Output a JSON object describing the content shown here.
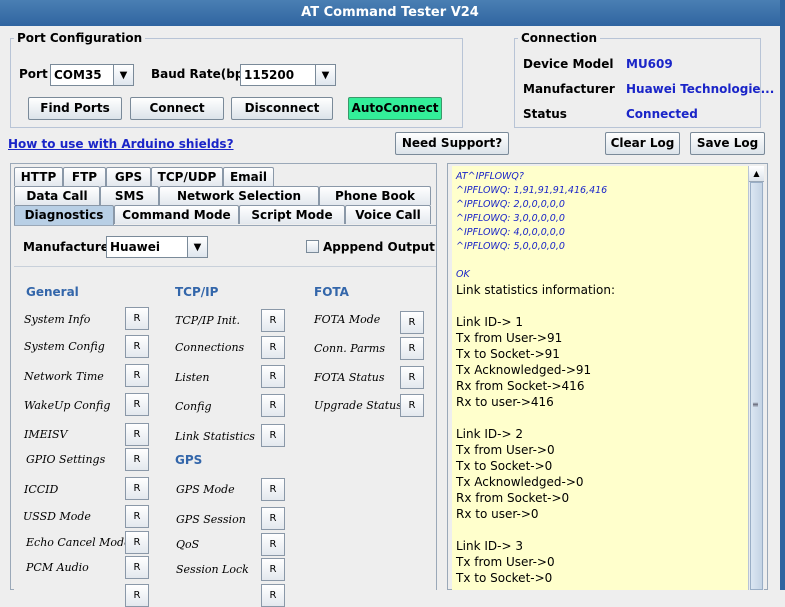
{
  "window": {
    "title": "AT Command Tester V24"
  },
  "port_config": {
    "title": "Port Configuration",
    "port_label": "Port",
    "port_value": "COM35",
    "baud_label": "Baud Rate(bps)",
    "baud_value": "115200",
    "find_ports": "Find Ports",
    "connect": "Connect",
    "disconnect": "Disconnect",
    "autoconnect": "AutoConnect"
  },
  "connection": {
    "title": "Connection",
    "device_model_label": "Device Model",
    "device_model_value": "MU609",
    "manufacturer_label": "Manufacturer",
    "manufacturer_value": "Huawei Technologie...",
    "status_label": "Status",
    "status_value": "Connected"
  },
  "links": {
    "arduino": "How to use with Arduino shields?"
  },
  "actions": {
    "need_support": "Need Support?",
    "clear_log": "Clear Log",
    "save_log": "Save Log"
  },
  "tabs": {
    "row1": [
      "HTTP",
      "FTP",
      "GPS",
      "TCP/UDP",
      "Email"
    ],
    "row2": [
      "Data Call",
      "SMS",
      "Network Selection",
      "Phone Book"
    ],
    "row3": [
      "Diagnostics",
      "Command Mode",
      "Script Mode",
      "Voice Call"
    ],
    "active": "Diagnostics"
  },
  "diagnostics": {
    "manufacturer_label": "Manufacturer",
    "manufacturer_value": "Huawei",
    "append_output": "Apppend Output",
    "r_label": "R",
    "general": {
      "title": "General",
      "items": [
        "System Info",
        "System Config",
        "Network Time",
        "WakeUp Config",
        "IMEISV",
        "GPIO Settings",
        "ICCID",
        "USSD Mode",
        "Echo Cancel Mode",
        "PCM Audio"
      ]
    },
    "tcpip": {
      "title": "TCP/IP",
      "items": [
        "TCP/IP Init.",
        "Connections",
        "Listen",
        "Config",
        "Link Statistics"
      ]
    },
    "gps": {
      "title": "GPS",
      "items": [
        "GPS Mode",
        "GPS Session",
        "QoS",
        "Session Lock"
      ]
    },
    "fota": {
      "title": "FOTA",
      "items": [
        "FOTA Mode",
        "Conn. Parms",
        "FOTA Status",
        "Upgrade Status"
      ]
    }
  },
  "log": {
    "small": [
      "AT^IPFLOWQ?",
      "^IPFLOWQ: 1,91,91,91,416,416",
      "^IPFLOWQ: 2,0,0,0,0,0",
      "^IPFLOWQ: 3,0,0,0,0,0",
      "^IPFLOWQ: 4,0,0,0,0,0",
      "^IPFLOWQ: 5,0,0,0,0,0",
      "",
      "OK"
    ],
    "lines": [
      "Link statistics information:",
      "",
      "Link ID-> 1",
      "Tx from User->91",
      "Tx to Socket->91",
      "Tx Acknowledged->91",
      "Rx from Socket->416",
      "Rx to user->416",
      "",
      "Link ID-> 2",
      "Tx from User->0",
      "Tx to Socket->0",
      "Tx Acknowledged->0",
      "Rx from Socket->0",
      "Rx to user->0",
      "",
      "Link ID-> 3",
      "Tx from User->0",
      "Tx to Socket->0"
    ]
  }
}
